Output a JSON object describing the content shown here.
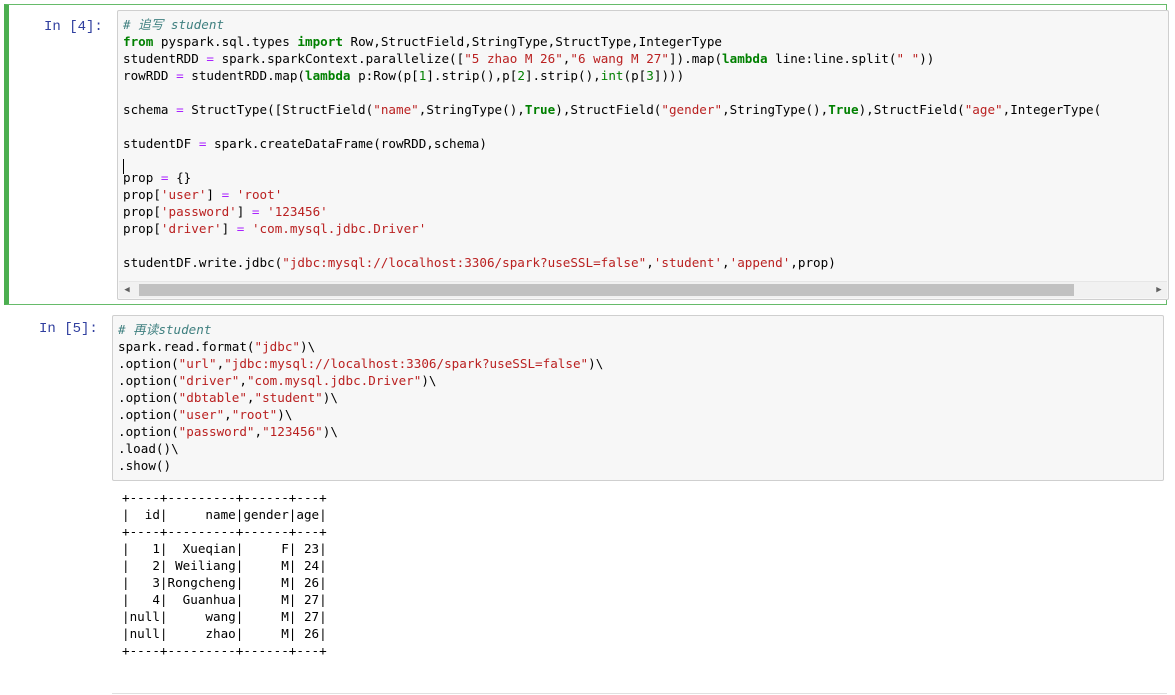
{
  "cell4": {
    "prompt": "In  [4]:",
    "comment": "# 追写 student",
    "lines": {
      "l2_kw": "from",
      "l2_a": " pyspark.sql.types ",
      "l2_kw2": "import",
      "l2_b": " Row,StructField,StringType,StructType,IntegerType",
      "l3_a": "studentRDD ",
      "l3_op": "=",
      "l3_b": " spark.sparkContext.parallelize([",
      "l3_s1": "\"5 zhao M 26\"",
      "l3_c": ",",
      "l3_s2": "\"6 wang M 27\"",
      "l3_d": "]).map(",
      "l3_kw": "lambda",
      "l3_e": " line:line.split(",
      "l3_s3": "\" \"",
      "l3_f": "))",
      "l4_a": "rowRDD ",
      "l4_op": "=",
      "l4_b": " studentRDD.map(",
      "l4_kw": "lambda",
      "l4_c": " p:Row(p[",
      "l4_n1": "1",
      "l4_d": "].strip(),p[",
      "l4_n2": "2",
      "l4_e": "].strip(),",
      "l4_fn": "int",
      "l4_f": "(p[",
      "l4_n3": "3",
      "l4_g": "])))",
      "l6_a": "schema ",
      "l6_op": "=",
      "l6_b": " StructType([StructField(",
      "l6_s1": "\"name\"",
      "l6_c": ",StringType(),",
      "l6_kw1": "True",
      "l6_d": "),StructField(",
      "l6_s2": "\"gender\"",
      "l6_e": ",StringType(),",
      "l6_kw2": "True",
      "l6_f": "),StructField(",
      "l6_s3": "\"age\"",
      "l6_g": ",IntegerType(",
      "l8_a": "studentDF ",
      "l8_op": "=",
      "l8_b": " spark.createDataFrame(rowRDD,schema)",
      "l10_a": "prop ",
      "l10_op": "=",
      "l10_b": " {}",
      "l11_a": "prop[",
      "l11_s1": "'user'",
      "l11_b": "] ",
      "l11_op": "=",
      "l11_c": " ",
      "l11_s2": "'root'",
      "l12_a": "prop[",
      "l12_s1": "'password'",
      "l12_b": "] ",
      "l12_op": "=",
      "l12_c": " ",
      "l12_s2": "'123456'",
      "l13_a": "prop[",
      "l13_s1": "'driver'",
      "l13_b": "] ",
      "l13_op": "=",
      "l13_c": " ",
      "l13_s2": "'com.mysql.jdbc.Driver'",
      "l15_a": "studentDF.write.jdbc(",
      "l15_s1": "\"jdbc:mysql://localhost:3306/spark?useSSL=false\"",
      "l15_b": ",",
      "l15_s2": "'student'",
      "l15_c": ",",
      "l15_s3": "'append'",
      "l15_d": ",prop)"
    }
  },
  "cell5": {
    "prompt": "In  [5]:",
    "comment": "# 再读student",
    "lines": {
      "r1_a": "spark.read.format(",
      "r1_s": "\"jdbc\"",
      "r1_b": ")\\",
      "r2_a": ".option(",
      "r2_s1": "\"url\"",
      "r2_b": ",",
      "r2_s2": "\"jdbc:mysql://localhost:3306/spark?useSSL=false\"",
      "r2_c": ")\\",
      "r3_a": ".option(",
      "r3_s1": "\"driver\"",
      "r3_b": ",",
      "r3_s2": "\"com.mysql.jdbc.Driver\"",
      "r3_c": ")\\",
      "r4_a": ".option(",
      "r4_s1": "\"dbtable\"",
      "r4_b": ",",
      "r4_s2": "\"student\"",
      "r4_c": ")\\",
      "r5_a": ".option(",
      "r5_s1": "\"user\"",
      "r5_b": ",",
      "r5_s2": "\"root\"",
      "r5_c": ")\\",
      "r6_a": ".option(",
      "r6_s1": "\"password\"",
      "r6_b": ",",
      "r6_s2": "\"123456\"",
      "r6_c": ")\\",
      "r7": ".load()\\",
      "r8": ".show()"
    },
    "output": {
      "border": "+----+---------+------+---+",
      "header": "|  id|     name|gender|age|",
      "rows": [
        "|   1|  Xueqian|     F| 23|",
        "|   2| Weiliang|     M| 24|",
        "|   3|Rongcheng|     M| 26|",
        "|   4|  Guanhua|     M| 27|",
        "|null|     wang|     M| 27|",
        "|null|     zhao|     M| 26|"
      ]
    }
  }
}
